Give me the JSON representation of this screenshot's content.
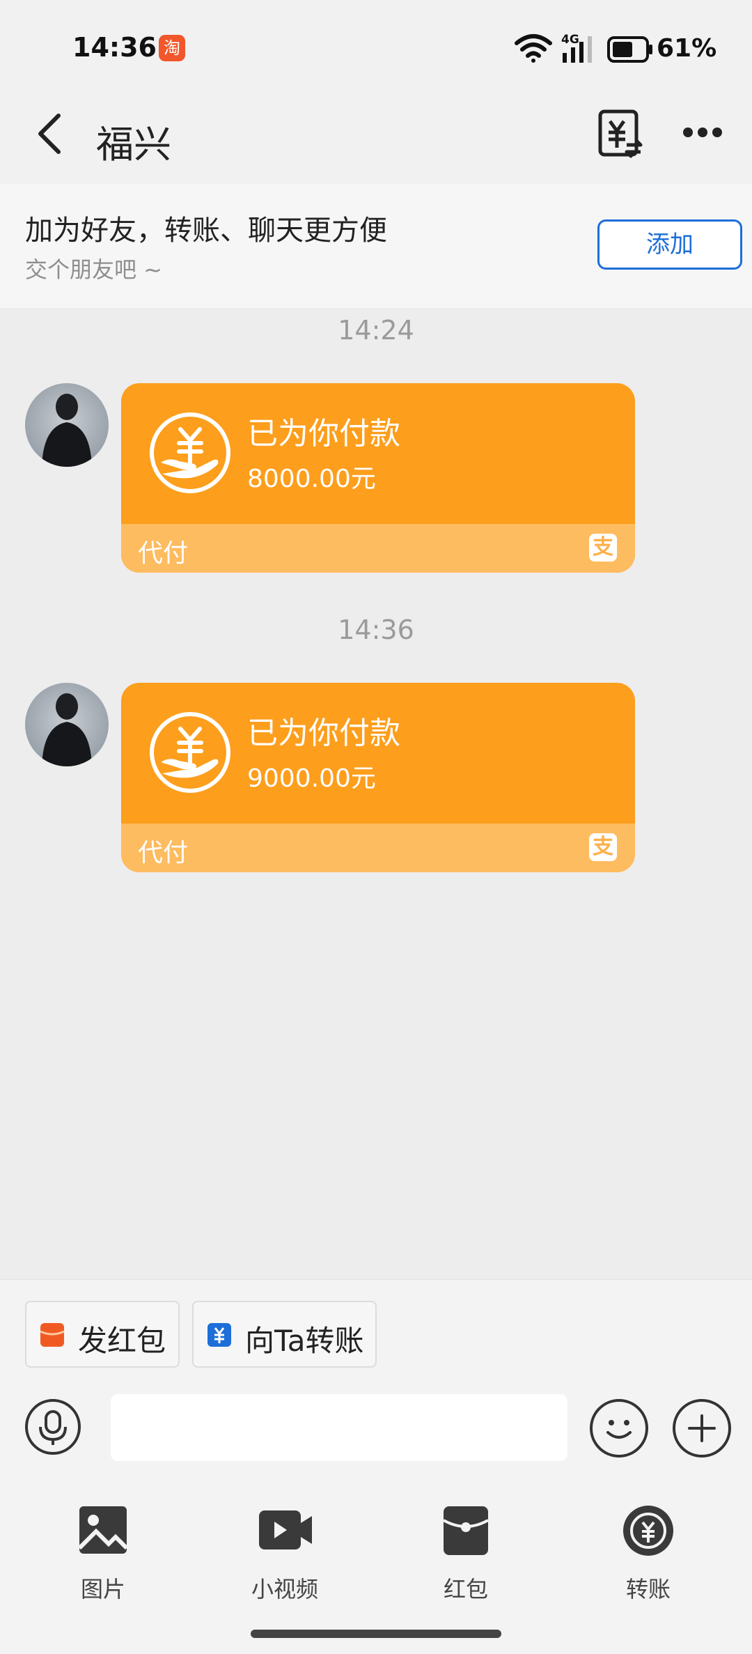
{
  "status_bar": {
    "time": "14:36",
    "app_badge": "淘",
    "network": "4G",
    "battery": "61%"
  },
  "nav": {
    "title": "福兴"
  },
  "banner": {
    "title": "加为好友，转账、聊天更方便",
    "subtitle": "交个朋友吧 ~",
    "add_label": "添加"
  },
  "messages": [
    {
      "timestamp": "14:24",
      "card_title": "已为你付款",
      "amount": "8000.00元",
      "footer_label": "代付"
    },
    {
      "timestamp": "14:36",
      "card_title": "已为你付款",
      "amount": "9000.00元",
      "footer_label": "代付"
    }
  ],
  "quick_actions": [
    {
      "label": "发红包"
    },
    {
      "label": "向Ta转账"
    }
  ],
  "toolbar": [
    {
      "label": "图片",
      "icon": "image-icon"
    },
    {
      "label": "小视频",
      "icon": "video-icon"
    },
    {
      "label": "红包",
      "icon": "red-packet-icon"
    },
    {
      "label": "转账",
      "icon": "transfer-icon"
    }
  ],
  "colors": {
    "card": "#fd9e1c",
    "card_footer": "#fdbc60",
    "accent_blue": "#1d6ed8",
    "red_packet": "#f05a22"
  }
}
